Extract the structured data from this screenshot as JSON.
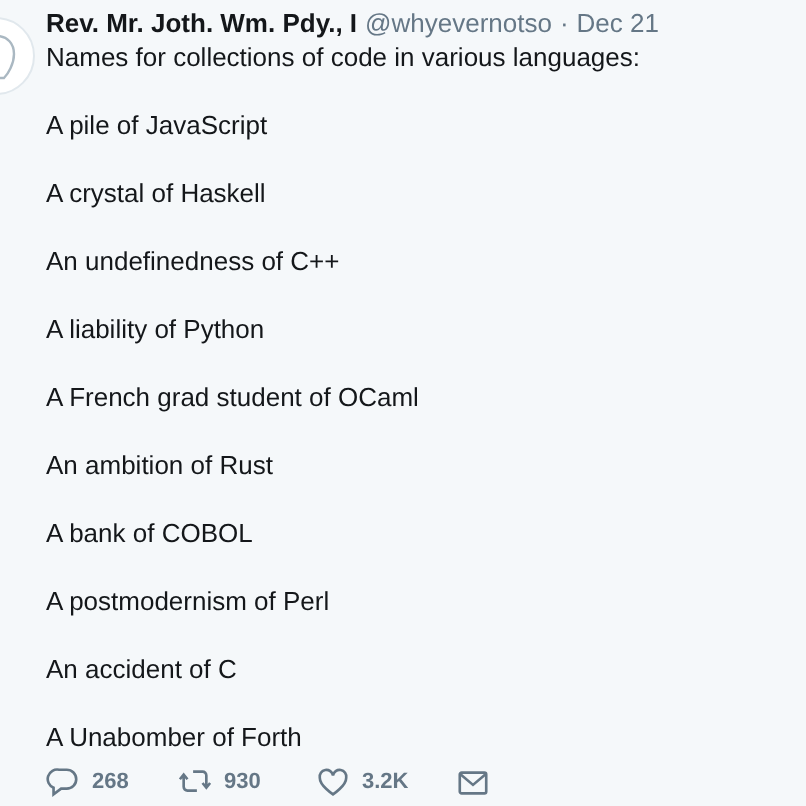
{
  "tweet": {
    "author_name": "Rev. Mr. Joth. Wm. Pdy., I",
    "handle": "@whyevernotso",
    "separator": "·",
    "date": "Dec 21",
    "intro": "Names for collections of code in various languages:",
    "lines": [
      "A pile of JavaScript",
      "A crystal of Haskell",
      "An undefinedness of C++",
      "A liability of Python",
      "A French grad student of OCaml",
      "An ambition of Rust",
      "A bank of COBOL",
      "A postmodernism of Perl",
      "An accident of C",
      "A Unabomber of Forth"
    ],
    "actions": [
      {
        "kind": "reply",
        "count": "268"
      },
      {
        "kind": "retweet",
        "count": "930"
      },
      {
        "kind": "like",
        "count": "3.2K"
      },
      {
        "kind": "message"
      }
    ]
  }
}
